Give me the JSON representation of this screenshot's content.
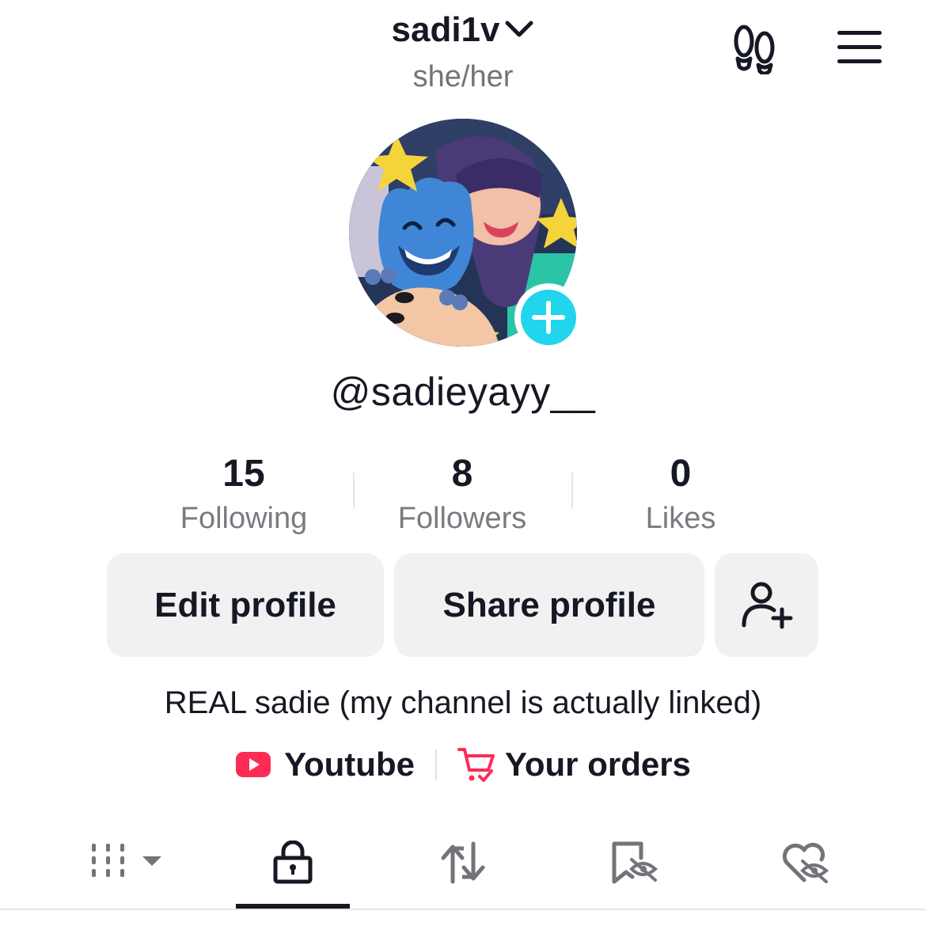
{
  "header": {
    "display_name": "sadi1v",
    "pronouns": "she/her",
    "icons": [
      "chevron-down-icon",
      "footprints-icon",
      "menu-icon"
    ]
  },
  "profile": {
    "username": "@sadieyayy__",
    "avatar_badge_icon": "plus-icon",
    "badge_color": "#20d5ec"
  },
  "stats": [
    {
      "value": "15",
      "label": "Following"
    },
    {
      "value": "8",
      "label": "Followers"
    },
    {
      "value": "0",
      "label": "Likes"
    }
  ],
  "actions": {
    "edit_label": "Edit profile",
    "share_label": "Share profile",
    "add_friend_icon": "add-user-icon"
  },
  "bio": "REAL sadie (my channel is actually linked)",
  "links": [
    {
      "label": "Youtube",
      "icon": "youtube-icon",
      "color": "#fe2c55"
    },
    {
      "label": "Your orders",
      "icon": "cart-icon",
      "color": "#fe2c55"
    }
  ],
  "tabs": [
    {
      "icon": "grid-icon",
      "selected": false
    },
    {
      "icon": "lock-icon",
      "selected": true
    },
    {
      "icon": "repost-icon",
      "selected": false
    },
    {
      "icon": "bookmark-hidden-icon",
      "selected": false
    },
    {
      "icon": "liked-hidden-icon",
      "selected": false
    }
  ]
}
